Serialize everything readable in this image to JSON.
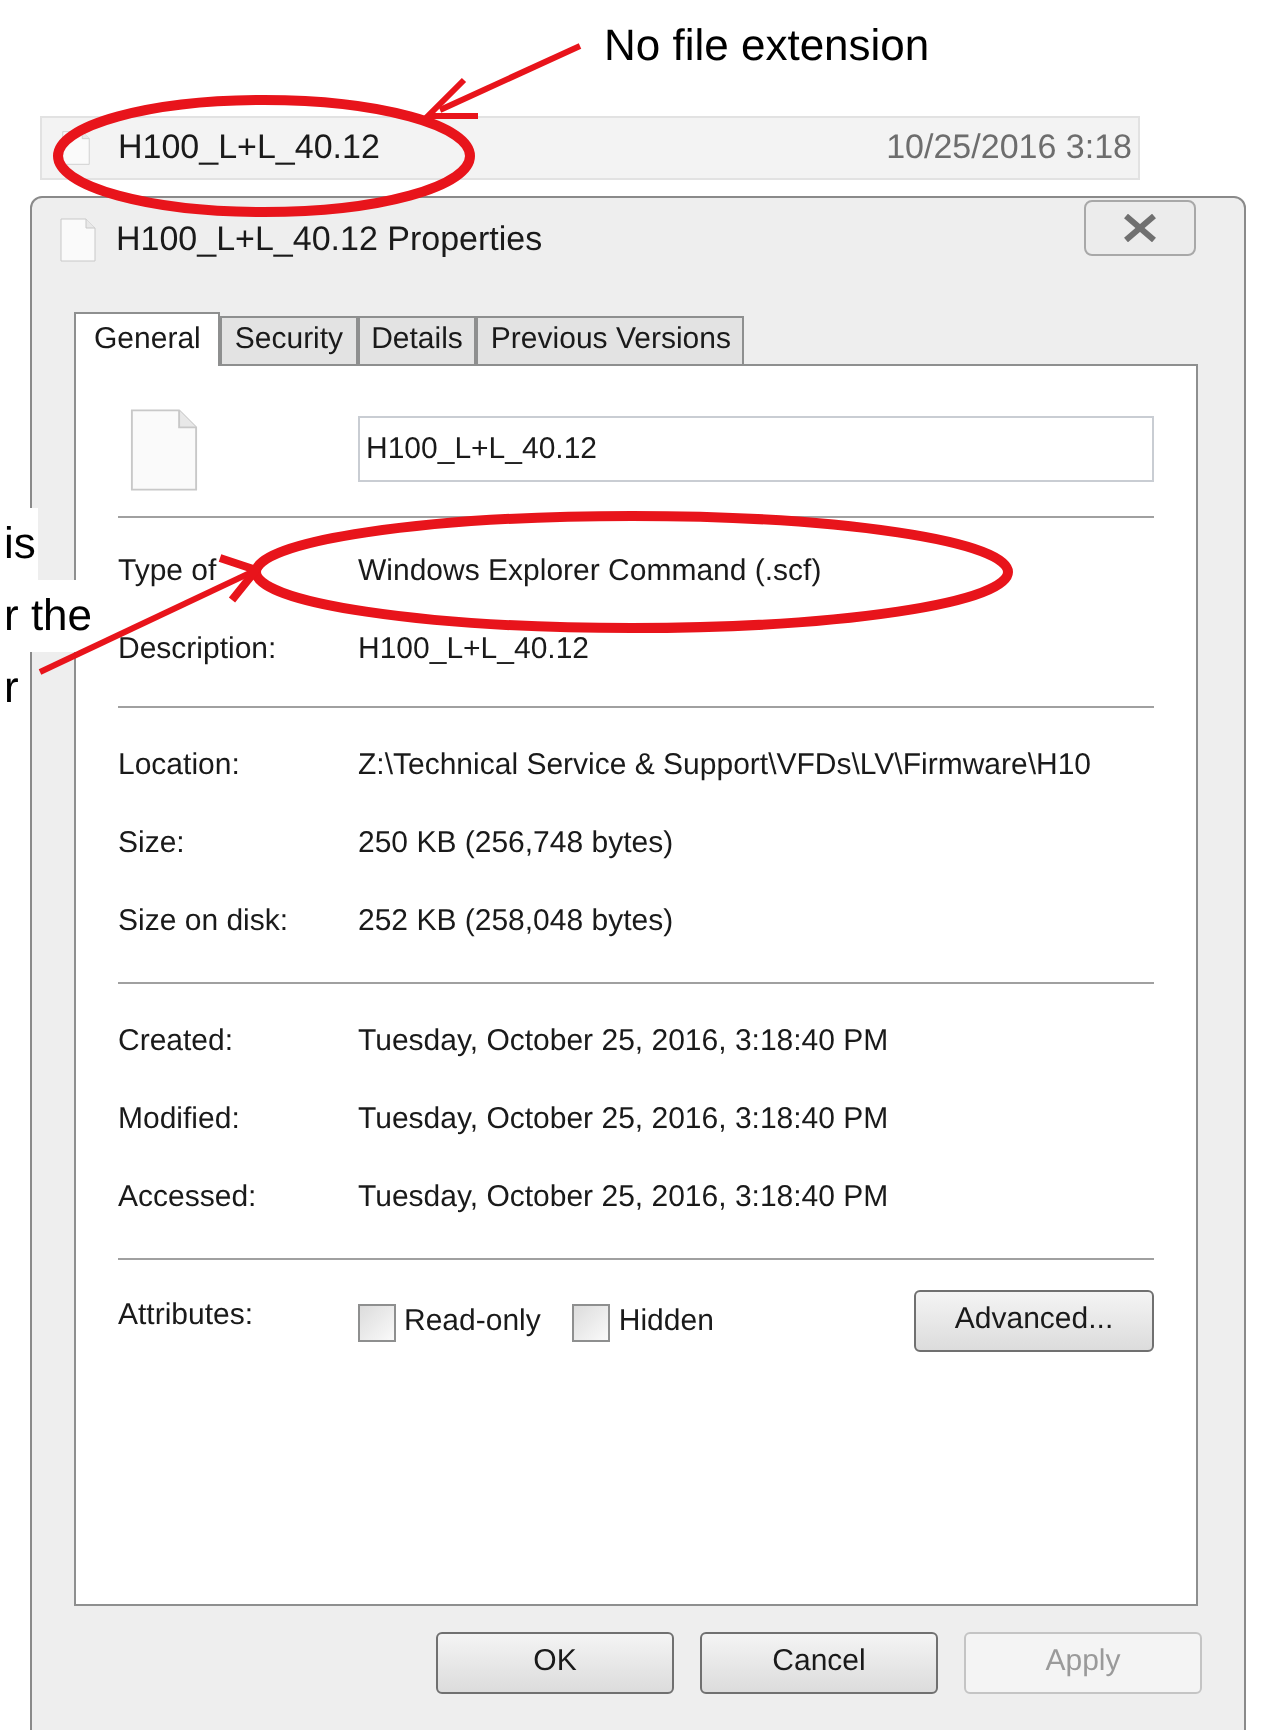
{
  "annotations": {
    "callout": "No file extension",
    "side_note_lines": [
      "is",
      "r the",
      "r"
    ]
  },
  "explorer_row": {
    "name": "H100_L+L_40.12",
    "date_modified": "10/25/2016 3:18"
  },
  "window": {
    "title": "H100_L+L_40.12 Properties"
  },
  "tabs": [
    {
      "label": "General",
      "selected": true
    },
    {
      "label": "Security",
      "selected": false
    },
    {
      "label": "Details",
      "selected": false
    },
    {
      "label": "Previous Versions",
      "selected": false
    }
  ],
  "file_name_field": {
    "value": "H100_L+L_40.12"
  },
  "sections": [
    [
      {
        "label": "Type of",
        "value": "Windows Explorer Command (.scf)"
      },
      {
        "label": "Description:",
        "value": "H100_L+L_40.12"
      }
    ],
    [
      {
        "label": "Location:",
        "value": "Z:\\Technical Service & Support\\VFDs\\LV\\Firmware\\H10"
      },
      {
        "label": "Size:",
        "value": "250 KB (256,748 bytes)"
      },
      {
        "label": "Size on disk:",
        "value": "252 KB (258,048 bytes)"
      }
    ],
    [
      {
        "label": "Created:",
        "value": "Tuesday, October 25, 2016, 3:18:40 PM"
      },
      {
        "label": "Modified:",
        "value": "Tuesday, October 25, 2016, 3:18:40 PM"
      },
      {
        "label": "Accessed:",
        "value": "Tuesday, October 25, 2016, 3:18:40 PM"
      }
    ]
  ],
  "attributes": {
    "label": "Attributes:",
    "checkboxes": [
      {
        "label": "Read-only",
        "checked": false
      },
      {
        "label": "Hidden",
        "checked": false
      }
    ],
    "advanced_button": "Advanced..."
  },
  "buttons": [
    {
      "label": "OK",
      "disabled": false
    },
    {
      "label": "Cancel",
      "disabled": false
    },
    {
      "label": "Apply",
      "disabled": true
    }
  ]
}
